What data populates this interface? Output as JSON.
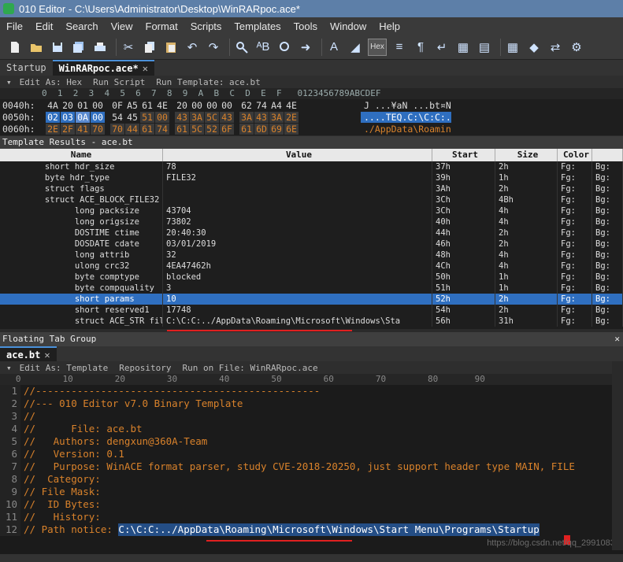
{
  "window": {
    "title": "010 Editor - C:\\Users\\Administrator\\Desktop\\WinRARpoc.ace*"
  },
  "menu": [
    "File",
    "Edit",
    "Search",
    "View",
    "Format",
    "Scripts",
    "Templates",
    "Tools",
    "Window",
    "Help"
  ],
  "toolbar": {
    "hex_label": "Hex"
  },
  "tabs": [
    {
      "label": "Startup"
    },
    {
      "label": "WinRARpoc.ace*"
    }
  ],
  "hex_bar": {
    "edit_as": "Edit As: Hex",
    "run_script": "Run Script",
    "run_template": "Run Template: ace.bt"
  },
  "hex_header": "        0  1  2  3  4  5  6  7  8  9  A  B  C  D  E  F   0123456789ABCDEF",
  "hex_rows": [
    {
      "addr": "0040h:",
      "bytes": [
        "4A",
        "20",
        "01",
        "00",
        "0F",
        "A5",
        "61",
        "4E",
        "20",
        "00",
        "00",
        "00",
        "62",
        "74",
        "A4",
        "4E"
      ],
      "ascii": "J ...¥aN ...bt¤N"
    },
    {
      "addr": "0050h:",
      "bytes": [
        "02",
        "03",
        "0A",
        "00",
        "54",
        "45",
        "51",
        "00",
        "43",
        "3A",
        "5C",
        "43",
        "3A",
        "43",
        "3A",
        "2E"
      ],
      "ascii": "....TEQ.C:\\C:C:."
    },
    {
      "addr": "0060h:",
      "bytes": [
        "2E",
        "2F",
        "41",
        "70",
        "70",
        "44",
        "61",
        "74",
        "61",
        "5C",
        "52",
        "6F",
        "61",
        "6D",
        "69",
        "6E"
      ],
      "ascii": "./AppData\\Roamin"
    }
  ],
  "template_results": {
    "title": "Template Results - ace.bt",
    "headers": [
      "Name",
      "Value",
      "Start",
      "Size",
      "Color",
      ""
    ]
  },
  "rows": [
    {
      "name": "short hdr_size",
      "value": "78",
      "start": "37h",
      "size": "2h",
      "c1": "Fg:",
      "c2": "Bg:"
    },
    {
      "name": "byte hdr_type",
      "value": "FILE32",
      "start": "39h",
      "size": "1h",
      "c1": "Fg:",
      "c2": "Bg:"
    },
    {
      "name": "struct flags",
      "value": "",
      "start": "3Ah",
      "size": "2h",
      "c1": "Fg:",
      "c2": "Bg:"
    },
    {
      "name": "struct ACE_BLOCK_FILE32",
      "value": "",
      "start": "3Ch",
      "size": "4Bh",
      "c1": "Fg:",
      "c2": "Bg:"
    },
    {
      "name": "long packsize",
      "value": "43704",
      "start": "3Ch",
      "size": "4h",
      "c1": "Fg:",
      "c2": "Bg:"
    },
    {
      "name": "long origsize",
      "value": "73802",
      "start": "40h",
      "size": "4h",
      "c1": "Fg:",
      "c2": "Bg:"
    },
    {
      "name": "DOSTIME ctime",
      "value": "20:40:30",
      "start": "44h",
      "size": "2h",
      "c1": "Fg:",
      "c2": "Bg:"
    },
    {
      "name": "DOSDATE cdate",
      "value": "03/01/2019",
      "start": "46h",
      "size": "2h",
      "c1": "Fg:",
      "c2": "Bg:"
    },
    {
      "name": "long attrib",
      "value": "32",
      "start": "48h",
      "size": "4h",
      "c1": "Fg:",
      "c2": "Bg:"
    },
    {
      "name": "ulong crc32",
      "value": "4EA47462h",
      "start": "4Ch",
      "size": "4h",
      "c1": "Fg:",
      "c2": "Bg:"
    },
    {
      "name": "byte comptype",
      "value": "blocked",
      "start": "50h",
      "size": "1h",
      "c1": "Fg:",
      "c2": "Bg:"
    },
    {
      "name": "byte compquality",
      "value": "3",
      "start": "51h",
      "size": "1h",
      "c1": "Fg:",
      "c2": "Bg:"
    },
    {
      "name": "short params",
      "value": "10",
      "start": "52h",
      "size": "2h",
      "c1": "Fg:",
      "c2": "Bg:"
    },
    {
      "name": "short reserved1",
      "value": "17748",
      "start": "54h",
      "size": "2h",
      "c1": "Fg:",
      "c2": "Bg:"
    },
    {
      "name": "struct ACE_STR filename",
      "value": "C:\\C:C:../AppData\\Roaming\\Microsoft\\Windows\\Sta",
      "start": "56h",
      "size": "31h",
      "c1": "Fg:",
      "c2": "Bg:"
    }
  ],
  "floating": {
    "title": "Floating Tab Group",
    "tab": "ace.bt"
  },
  "editor_bar": {
    "edit_as": "Edit As: Template",
    "repository": "Repository",
    "run_on_file": "Run on File: WinRARpoc.ace"
  },
  "ruler": "   0        10        20        30        40        50        60        70        80       90",
  "code": [
    {
      "n": "1",
      "t": "//------------------------------------------------"
    },
    {
      "n": "2",
      "t": "//--- 010 Editor v7.0 Binary Template"
    },
    {
      "n": "3",
      "t": "//"
    },
    {
      "n": "4",
      "t": "//      File: ace.bt"
    },
    {
      "n": "5",
      "t": "//   Authors: dengxun@360A-Team"
    },
    {
      "n": "6",
      "t": "//   Version: 0.1"
    },
    {
      "n": "7",
      "t": "//   Purpose: WinACE format parser, study CVE-2018-20250, just support header type MAIN, FILE"
    },
    {
      "n": "8",
      "t": "//  Category:"
    },
    {
      "n": "9",
      "t": "// File Mask:"
    },
    {
      "n": "10",
      "t": "//  ID Bytes:"
    },
    {
      "n": "11",
      "t": "//   History:"
    },
    {
      "n": "12",
      "t": "// Path notice: "
    }
  ],
  "path_notice": "C:\\C:C:../AppData\\Roaming\\Microsoft\\Windows\\Start Menu\\Programs\\Startup",
  "watermark": "https://blog.csdn.net/qq_29910839"
}
